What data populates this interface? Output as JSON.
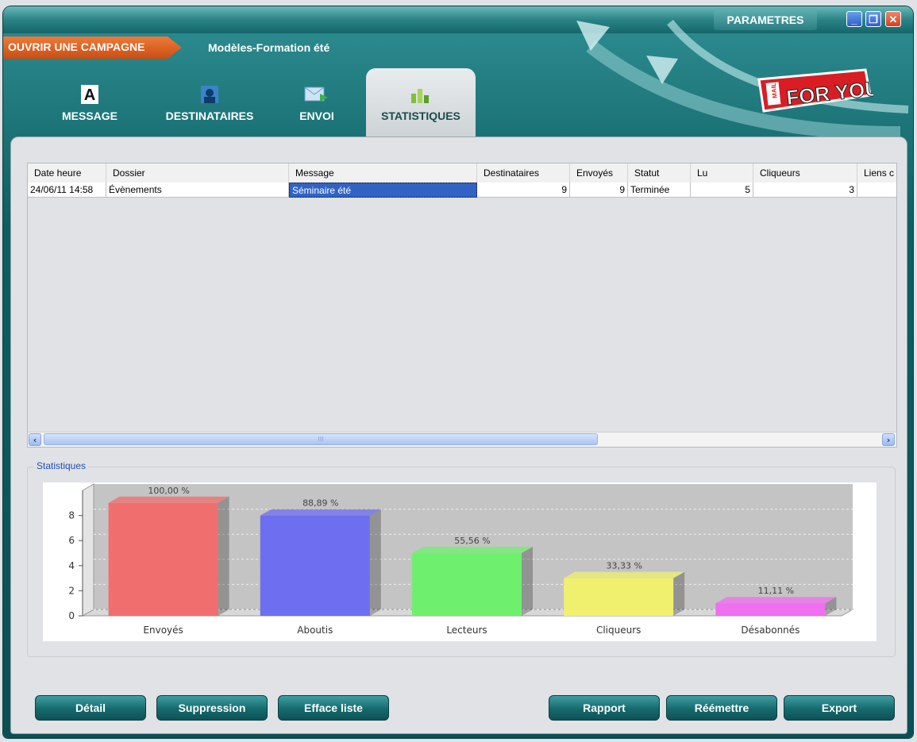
{
  "window": {
    "params_label": "PARAMETRES"
  },
  "campaign": {
    "open_label": "OUVRIR UNE CAMPAGNE",
    "title": "Modèles-Formation été"
  },
  "tabs": [
    {
      "label": "MESSAGE",
      "icon": "message-icon"
    },
    {
      "label": "DESTINATAIRES",
      "icon": "recipients-icon"
    },
    {
      "label": "ENVOI",
      "icon": "send-icon"
    },
    {
      "label": "STATISTIQUES",
      "icon": "stats-icon",
      "active": true
    }
  ],
  "table": {
    "headers": [
      "Date heure",
      "Dossier",
      "Message",
      "Destinataires",
      "Envoyés",
      "Statut",
      "Lu",
      "Cliqueurs",
      "Liens c"
    ],
    "rows": [
      [
        "24/06/11 14:58",
        "Évènements",
        "Séminaire été",
        "9",
        "9",
        "Terminée",
        "5",
        "3",
        ""
      ]
    ],
    "scroll_grip": "III"
  },
  "stats": {
    "legend": "Statistiques"
  },
  "chart_data": {
    "type": "bar",
    "categories": [
      "Envoyés",
      "Aboutis",
      "Lecteurs",
      "Cliqueurs",
      "Désabonnés"
    ],
    "values": [
      9,
      8,
      5,
      3,
      1
    ],
    "labels": [
      "100,00 %",
      "88,89 %",
      "55,56 %",
      "33,33 %",
      "11,11 %"
    ],
    "colors": [
      "#f06e6e",
      "#6e6ef0",
      "#6ef06e",
      "#f0f06e",
      "#f06ef0"
    ],
    "yticks": [
      "0",
      "2",
      "4",
      "6",
      "8"
    ],
    "ylim": [
      0,
      10
    ],
    "grid": true
  },
  "buttons": {
    "detail": "Détail",
    "suppression": "Suppression",
    "efface": "Efface liste",
    "rapport": "Rapport",
    "reemettre": "Réémettre",
    "export": "Export"
  },
  "logo": {
    "text": "FOR YOU",
    "small": "MAIL"
  }
}
